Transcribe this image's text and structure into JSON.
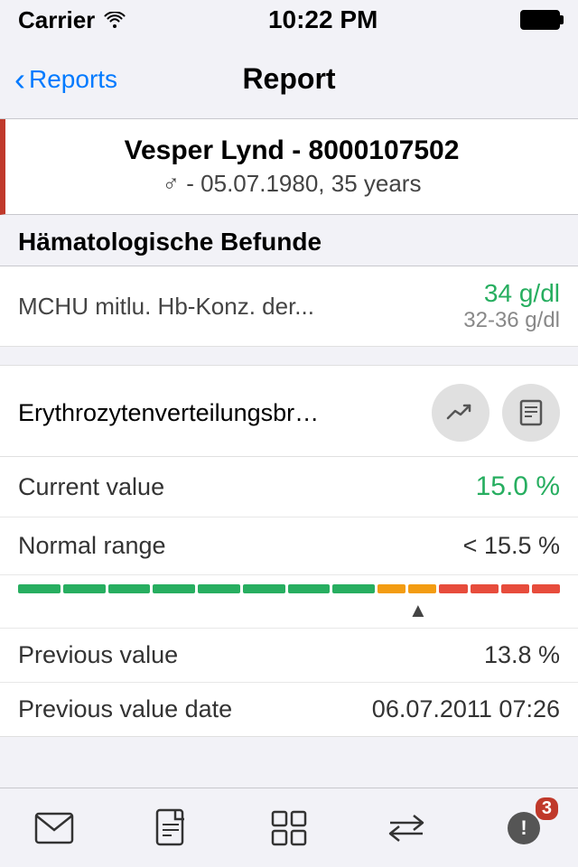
{
  "status_bar": {
    "carrier": "Carrier",
    "wifi": "📶",
    "time": "10:22 PM"
  },
  "nav": {
    "back_label": "Reports",
    "title": "Report"
  },
  "patient": {
    "name": "Vesper Lynd - 8000107502",
    "gender_symbol": "♂",
    "dob": "05.07.1980, 35 years"
  },
  "section": {
    "title": "Hämatologische Befunde"
  },
  "truncated_item": {
    "label": "MCHU mitlu. Hb-Konz. der...",
    "value": "34 g/dl",
    "normal_range": "32-36 g/dl"
  },
  "detail": {
    "name": "Erythrozytenverteilungsbr…",
    "current_value_label": "Current value",
    "current_value": "15.0 %",
    "normal_range_label": "Normal range",
    "normal_range": "< 15.5 %",
    "previous_value_label": "Previous value",
    "previous_value": "13.8 %",
    "previous_date_label": "Previous value date",
    "previous_date": "06.07.2011 07:26"
  },
  "range_bar": {
    "segments": [
      {
        "color": "#27ae60",
        "flex": 3
      },
      {
        "color": "#27ae60",
        "flex": 3
      },
      {
        "color": "#27ae60",
        "flex": 3
      },
      {
        "color": "#27ae60",
        "flex": 3
      },
      {
        "color": "#f39c12",
        "flex": 1
      },
      {
        "color": "#e74c3c",
        "flex": 2
      },
      {
        "color": "#e74c3c",
        "flex": 2
      },
      {
        "color": "#e74c3c",
        "flex": 2
      }
    ],
    "indicator_offset_percent": 73
  },
  "tab_bar": {
    "items": [
      {
        "name": "mail-icon",
        "symbol": "✉",
        "badge": null
      },
      {
        "name": "pdf-icon",
        "symbol": "📄",
        "badge": null
      },
      {
        "name": "grid-icon",
        "symbol": "⊞",
        "badge": null
      },
      {
        "name": "transfer-icon",
        "symbol": "⇄",
        "badge": null
      },
      {
        "name": "alert-icon",
        "symbol": "!",
        "badge": "3",
        "circle": true
      }
    ]
  }
}
